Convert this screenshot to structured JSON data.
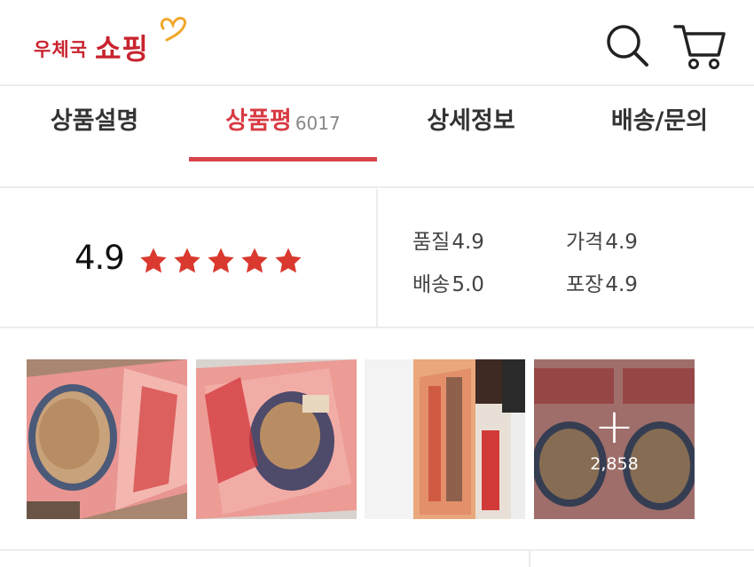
{
  "header": {
    "logo_small": "우체국",
    "logo_big": "쇼핑",
    "icons": [
      "search-icon",
      "cart-icon"
    ]
  },
  "tabs": [
    {
      "label": "상품설명",
      "active": false
    },
    {
      "label": "상품평",
      "count": "6017",
      "active": true
    },
    {
      "label": "상세정보",
      "active": false
    },
    {
      "label": "배송/문의",
      "active": false
    }
  ],
  "rating": {
    "score": "4.9",
    "stars": 5,
    "quality_label": "품질",
    "quality_value": "4.9",
    "price_label": "가격",
    "price_value": "4.9",
    "delivery_label": "배송",
    "delivery_value": "5.0",
    "packing_label": "포장",
    "packing_value": "4.9"
  },
  "photos": {
    "more_count": "2,858",
    "more_symbol": "+"
  },
  "colors": {
    "accent": "#d83b43",
    "brand": "#c8242f",
    "star": "#d9392f"
  }
}
